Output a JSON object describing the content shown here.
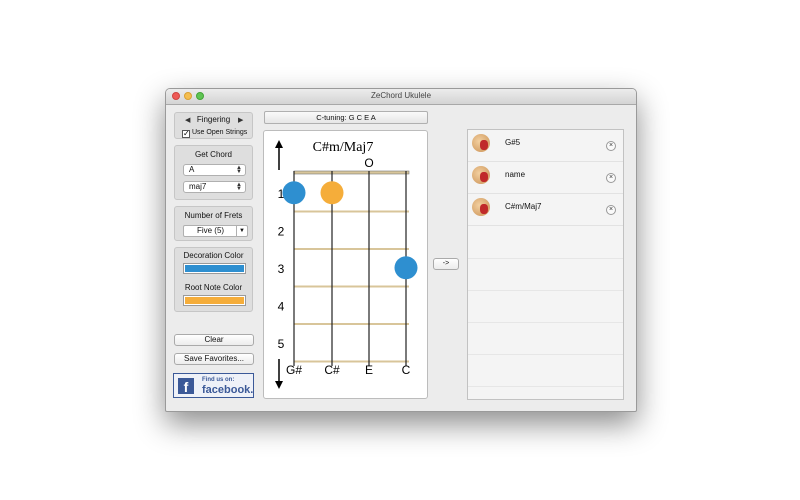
{
  "window": {
    "title": "ZeChord Ukulele"
  },
  "fingering": {
    "label": "Fingering",
    "prev": "◀",
    "next": "▶",
    "checkbox_checked": true,
    "checkbox_label": "Use Open Strings"
  },
  "get_chord": {
    "label": "Get Chord",
    "root": "A",
    "quality": "maj7"
  },
  "frets": {
    "label": "Number of Frets",
    "value": "Five (5)"
  },
  "decoration": {
    "label": "Decoration Color",
    "color": "#2e8fd0"
  },
  "root_note": {
    "label": "Root Note Color",
    "color": "#f5ad3a"
  },
  "buttons": {
    "clear": "Clear",
    "save_favorites": "Save Favorites...",
    "go": "->"
  },
  "facebook": {
    "icon": "f",
    "line1": "Find us on:",
    "line2": "facebook."
  },
  "tuning": "C-tuning: G C E A",
  "diagram": {
    "chord_name": "C#m/Maj7",
    "open_marker": "O",
    "fret_numbers": [
      "1",
      "2",
      "3",
      "4",
      "5"
    ],
    "string_names": [
      "G#",
      "C#",
      "E",
      "C"
    ],
    "up_arrow": "↑",
    "down_arrow": "↓",
    "dots": [
      {
        "string": 1,
        "fret": 1,
        "root": false
      },
      {
        "string": 2,
        "fret": 1,
        "root": true
      },
      {
        "string": 4,
        "fret": 3,
        "root": false
      }
    ]
  },
  "favorites": [
    {
      "name": "G#5",
      "remove": "×"
    },
    {
      "name": "name",
      "remove": "×"
    },
    {
      "name": "C#m/Maj7",
      "remove": "×"
    }
  ]
}
